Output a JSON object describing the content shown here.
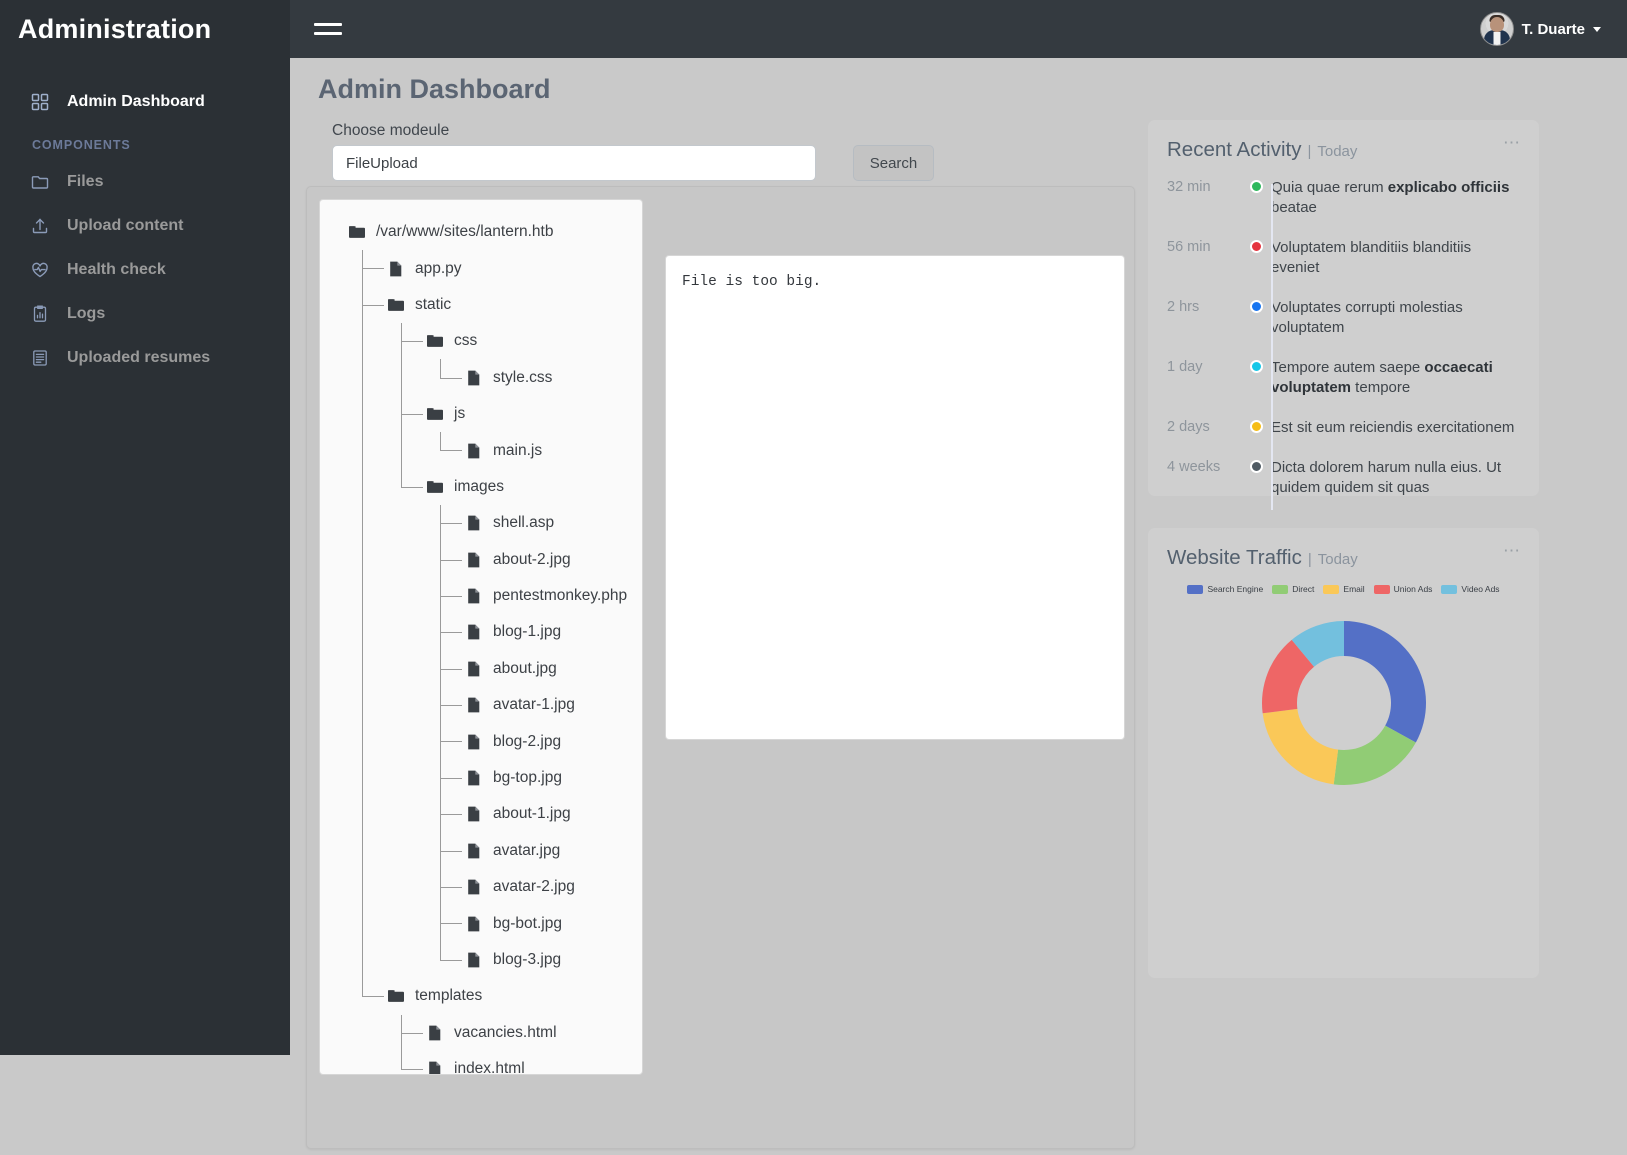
{
  "header": {
    "brand": "Administration",
    "menu_icon": "hamburger-icon",
    "user_name": "T. Duarte"
  },
  "sidebar": {
    "section_label": "COMPONENTS",
    "items": [
      {
        "label": "Admin Dashboard",
        "icon": "grid-icon",
        "active": true
      },
      {
        "label": "Files",
        "icon": "folder-icon",
        "active": false
      },
      {
        "label": "Upload content",
        "icon": "upload-icon",
        "active": false
      },
      {
        "label": "Health check",
        "icon": "heartbeat-icon",
        "active": false
      },
      {
        "label": "Logs",
        "icon": "clipboard-chart-icon",
        "active": false
      },
      {
        "label": "Uploaded resumes",
        "icon": "document-list-icon",
        "active": false
      }
    ]
  },
  "main": {
    "page_title": "Admin Dashboard",
    "search_label": "Choose modeule",
    "search_value": "FileUpload",
    "search_placeholder": "",
    "search_button": "Search",
    "output_text": "File is too big."
  },
  "tree": [
    {
      "label": "/var/www/sites/lantern.htb",
      "type": "folder",
      "depth": 0
    },
    {
      "label": "app.py",
      "type": "file",
      "depth": 1
    },
    {
      "label": "static",
      "type": "folder",
      "depth": 1
    },
    {
      "label": "css",
      "type": "folder",
      "depth": 2
    },
    {
      "label": "style.css",
      "type": "file",
      "depth": 3
    },
    {
      "label": "js",
      "type": "folder",
      "depth": 2
    },
    {
      "label": "main.js",
      "type": "file",
      "depth": 3
    },
    {
      "label": "images",
      "type": "folder",
      "depth": 2
    },
    {
      "label": "shell.asp",
      "type": "file",
      "depth": 3
    },
    {
      "label": "about-2.jpg",
      "type": "file",
      "depth": 3
    },
    {
      "label": "pentestmonkey.php",
      "type": "file",
      "depth": 3
    },
    {
      "label": "blog-1.jpg",
      "type": "file",
      "depth": 3
    },
    {
      "label": "about.jpg",
      "type": "file",
      "depth": 3
    },
    {
      "label": "avatar-1.jpg",
      "type": "file",
      "depth": 3
    },
    {
      "label": "blog-2.jpg",
      "type": "file",
      "depth": 3
    },
    {
      "label": "bg-top.jpg",
      "type": "file",
      "depth": 3
    },
    {
      "label": "about-1.jpg",
      "type": "file",
      "depth": 3
    },
    {
      "label": "avatar.jpg",
      "type": "file",
      "depth": 3
    },
    {
      "label": "avatar-2.jpg",
      "type": "file",
      "depth": 3
    },
    {
      "label": "bg-bot.jpg",
      "type": "file",
      "depth": 3
    },
    {
      "label": "blog-3.jpg",
      "type": "file",
      "depth": 3
    },
    {
      "label": "templates",
      "type": "folder",
      "depth": 1
    },
    {
      "label": "vacancies.html",
      "type": "file",
      "depth": 2
    },
    {
      "label": "index.html",
      "type": "file",
      "depth": 2
    }
  ],
  "activity_card": {
    "title": "Recent Activity",
    "separator": "|",
    "subtitle": "Today",
    "menu_icon": "ellipsis-icon",
    "items": [
      {
        "time": "32 min",
        "color": "#2eb85c",
        "text_pre": "Quia quae rerum ",
        "text_bold": "explicabo officiis",
        "text_post": " beatae"
      },
      {
        "time": "56 min",
        "color": "#e4343f",
        "text_pre": "Voluptatem blanditiis blanditiis eveniet",
        "text_bold": "",
        "text_post": ""
      },
      {
        "time": "2 hrs",
        "color": "#1875f0",
        "text_pre": "Voluptates corrupti molestias voluptatem",
        "text_bold": "",
        "text_post": ""
      },
      {
        "time": "1 day",
        "color": "#16c7e8",
        "text_pre": "Tempore autem saepe ",
        "text_bold": "occaecati voluptatem",
        "text_post": " tempore"
      },
      {
        "time": "2 days",
        "color": "#f6bd16",
        "text_pre": "Est sit eum reiciendis exercitationem",
        "text_bold": "",
        "text_post": ""
      },
      {
        "time": "4 weeks",
        "color": "#4f5a63",
        "text_pre": "Dicta dolorem harum nulla eius. Ut quidem quidem sit quas",
        "text_bold": "",
        "text_post": ""
      }
    ]
  },
  "traffic_card": {
    "title": "Website Traffic",
    "separator": "|",
    "subtitle": "Today",
    "menu_icon": "ellipsis-icon"
  },
  "chart_data": {
    "type": "pie",
    "title": "Website Traffic",
    "subtitle": "Today",
    "donut": true,
    "legend_position": "top",
    "categories": [
      "Search Engine",
      "Direct",
      "Email",
      "Union Ads",
      "Video Ads"
    ],
    "values": [
      33,
      19,
      21,
      16,
      11
    ],
    "colors": [
      "#5470c6",
      "#91cc75",
      "#fac858",
      "#ee6666",
      "#73c0de"
    ],
    "units": "percent"
  }
}
